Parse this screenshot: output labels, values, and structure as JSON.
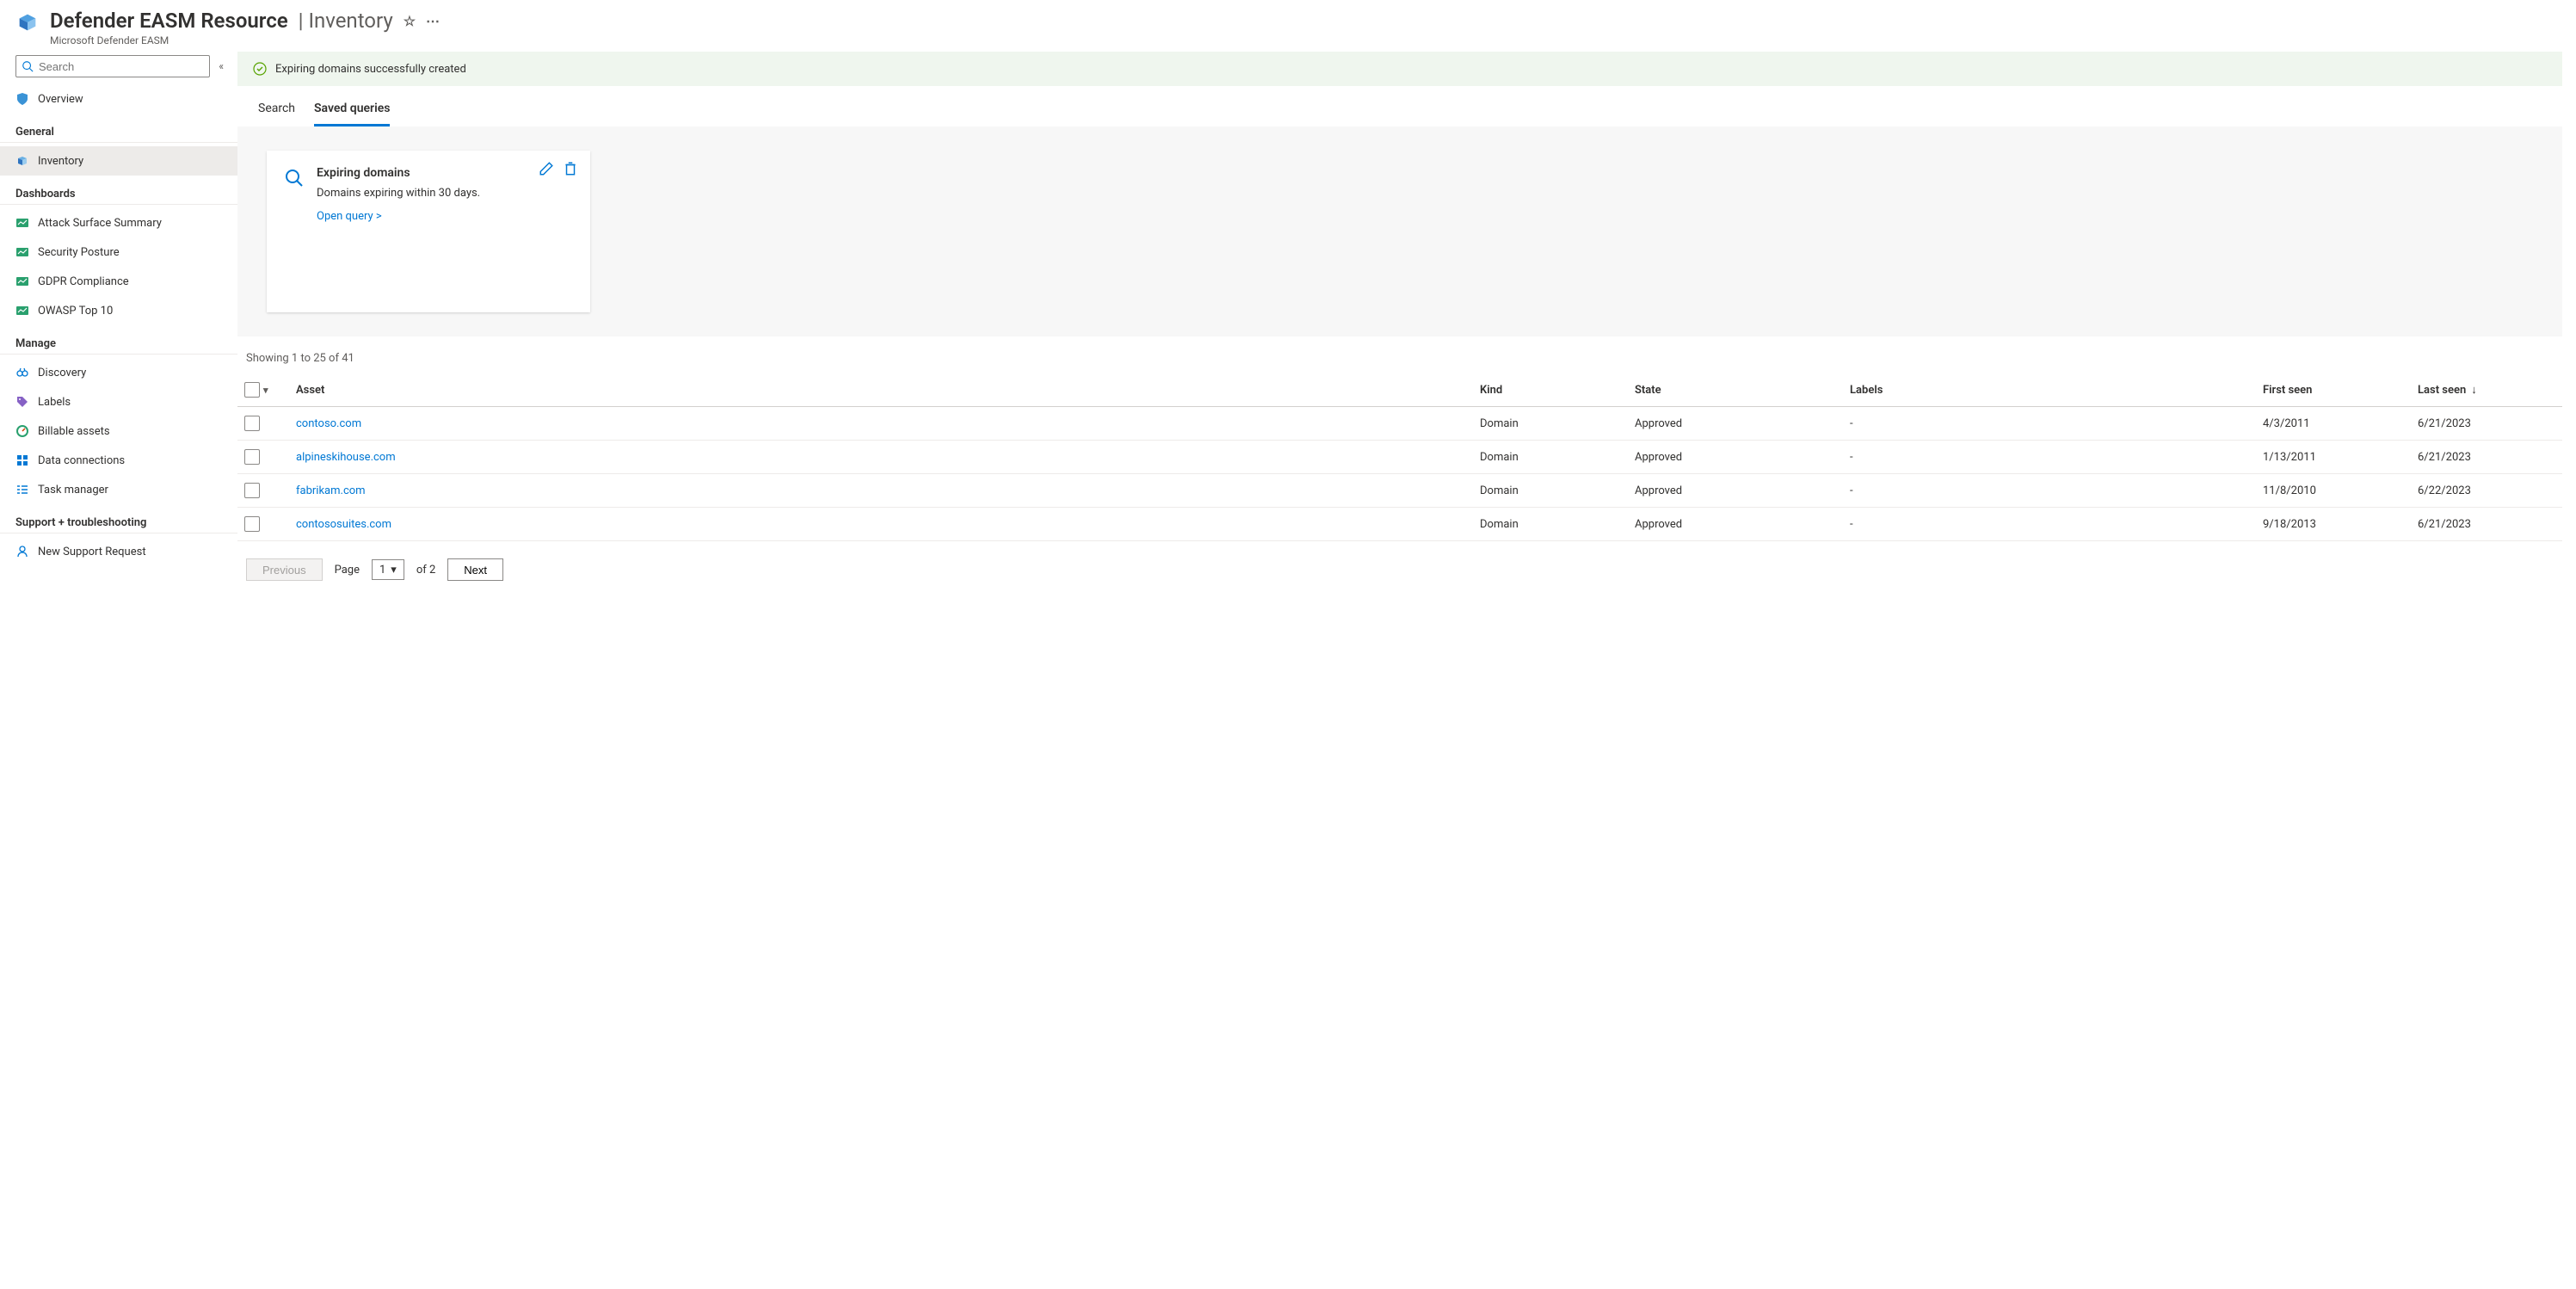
{
  "header": {
    "resource_name": "Defender EASM Resource",
    "page_name": "Inventory",
    "breadcrumb": "Microsoft Defender EASM"
  },
  "sidebar": {
    "search_placeholder": "Search",
    "overview_label": "Overview",
    "sections": {
      "general": {
        "title": "General",
        "inventory": "Inventory"
      },
      "dashboards": {
        "title": "Dashboards",
        "items": [
          "Attack Surface Summary",
          "Security Posture",
          "GDPR Compliance",
          "OWASP Top 10"
        ]
      },
      "manage": {
        "title": "Manage",
        "items": [
          "Discovery",
          "Labels",
          "Billable assets",
          "Data connections",
          "Task manager"
        ]
      },
      "support": {
        "title": "Support + troubleshooting",
        "new_support": "New Support Request"
      }
    }
  },
  "notice": {
    "text": "Expiring domains successfully created"
  },
  "tabs": {
    "search": "Search",
    "saved": "Saved queries"
  },
  "query_card": {
    "title": "Expiring domains",
    "description": "Domains expiring within 30 days.",
    "open_link": "Open query >"
  },
  "results_summary": "Showing 1 to 25 of 41",
  "table": {
    "headers": {
      "asset": "Asset",
      "kind": "Kind",
      "state": "State",
      "labels": "Labels",
      "first_seen": "First seen",
      "last_seen": "Last seen"
    },
    "rows": [
      {
        "asset": "contoso.com",
        "kind": "Domain",
        "state": "Approved",
        "labels": "-",
        "first_seen": "4/3/2011",
        "last_seen": "6/21/2023"
      },
      {
        "asset": "alpineskihouse.com",
        "kind": "Domain",
        "state": "Approved",
        "labels": "-",
        "first_seen": "1/13/2011",
        "last_seen": "6/21/2023"
      },
      {
        "asset": "fabrikam.com",
        "kind": "Domain",
        "state": "Approved",
        "labels": "-",
        "first_seen": "11/8/2010",
        "last_seen": "6/22/2023"
      },
      {
        "asset": "contososuites.com",
        "kind": "Domain",
        "state": "Approved",
        "labels": "-",
        "first_seen": "9/18/2013",
        "last_seen": "6/21/2023"
      }
    ]
  },
  "pagination": {
    "previous": "Previous",
    "page_label": "Page",
    "current_page": "1",
    "of_label": "of 2",
    "next": "Next"
  }
}
